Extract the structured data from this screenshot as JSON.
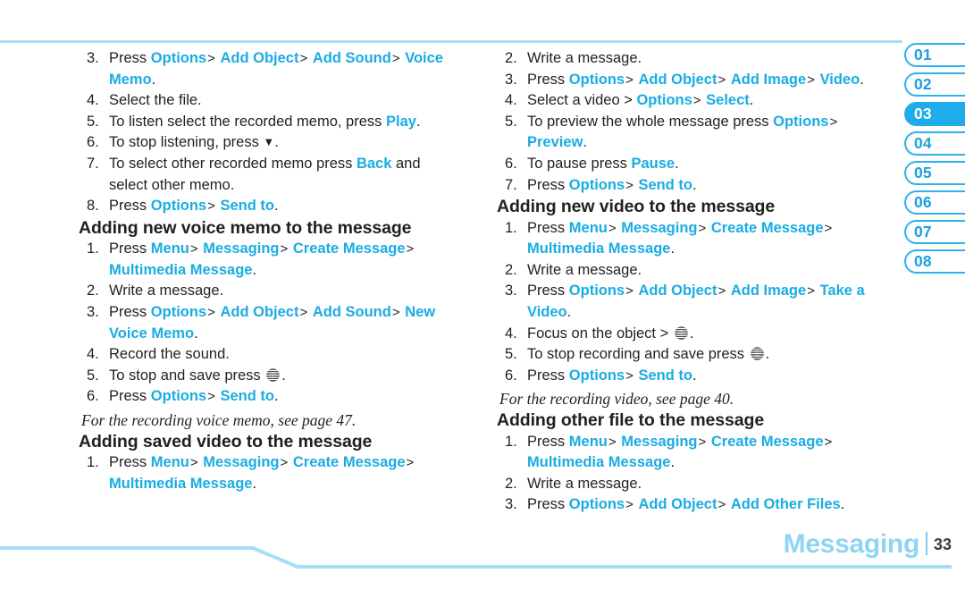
{
  "page": {
    "footer_title": "Messaging",
    "footer_page_number": "33",
    "accent_blue": "#19ace3",
    "rule_blue": "#a8ddf5",
    "tab_blue": "#2bb3ea",
    "tab_active_blue": "#1eadea",
    "footer_title_blue": "#8fd4f2",
    "body_black": "#231f20"
  },
  "tabs": [
    {
      "label": "01",
      "active": false
    },
    {
      "label": "02",
      "active": false
    },
    {
      "label": "03",
      "active": true
    },
    {
      "label": "04",
      "active": false
    },
    {
      "label": "05",
      "active": false
    },
    {
      "label": "06",
      "active": false
    },
    {
      "label": "07",
      "active": false
    },
    {
      "label": "08",
      "active": false
    }
  ],
  "left_column": {
    "continued_steps": [
      {
        "num": "3.",
        "text": "Press Options > Add Object > Add Sound > Voice Memo."
      },
      {
        "num": "4.",
        "text": "Select the file."
      },
      {
        "num": "5.",
        "text": "To listen select the recorded memo, press Play."
      },
      {
        "num": "6.",
        "text": "To stop listening, press ▼."
      },
      {
        "num": "7.",
        "text": "To select other recorded memo press Back and select other memo."
      },
      {
        "num": "8.",
        "text": "Press Options > Send to."
      }
    ],
    "section_voice_memo": {
      "heading": "Adding new voice memo to the message",
      "steps": [
        {
          "num": "1.",
          "text": "Press Menu > Messaging > Create Message > Multimedia Message."
        },
        {
          "num": "2.",
          "text": "Write a message."
        },
        {
          "num": "3.",
          "text": "Press Options > Add Object > Add Sound > New Voice Memo."
        },
        {
          "num": "4.",
          "text": "Record the sound."
        },
        {
          "num": "5.",
          "text": "To stop and save press [AT&T key]."
        },
        {
          "num": "6.",
          "text": "Press Options > Send to."
        }
      ],
      "footnote": "For the recording voice memo, see page 47."
    },
    "section_saved_video": {
      "heading": "Adding saved video to the message",
      "steps": [
        {
          "num": "1.",
          "text": "Press Menu > Messaging > Create Message > Multimedia Message."
        }
      ]
    }
  },
  "right_column": {
    "continued_steps": [
      {
        "num": "2.",
        "text": "Write a message."
      },
      {
        "num": "3.",
        "text": "Press Options > Add Object > Add Image > Video."
      },
      {
        "num": "4.",
        "text": "Select a video > Options > Select."
      },
      {
        "num": "5.",
        "text": "To preview the whole message press Options > Preview."
      },
      {
        "num": "6.",
        "text": "To pause press Pause."
      },
      {
        "num": "7.",
        "text": "Press Options > Send to."
      }
    ],
    "section_new_video": {
      "heading": "Adding new video to the message",
      "steps": [
        {
          "num": "1.",
          "text": "Press Menu > Messaging > Create Message > Multimedia Message."
        },
        {
          "num": "2.",
          "text": "Write a message."
        },
        {
          "num": "3.",
          "text": "Press Options > Add Object > Add Image > Take a Video."
        },
        {
          "num": "4.",
          "text": "Focus on the object > [AT&T key]."
        },
        {
          "num": "5.",
          "text": "To stop recording and save press [AT&T key]."
        },
        {
          "num": "6.",
          "text": "Press Options > Send to."
        }
      ],
      "footnote": "For the recording video, see page 40."
    },
    "section_other_file": {
      "heading": "Adding other file to the message",
      "steps": [
        {
          "num": "1.",
          "text": "Press Menu > Messaging > Create Message > Multimedia Message."
        },
        {
          "num": "2.",
          "text": "Write a message."
        },
        {
          "num": "3.",
          "text": "Press Options > Add Object > Add Other Files."
        }
      ]
    }
  },
  "keywords": {
    "press": "Press",
    "options": "Options",
    "add_object": "Add Object",
    "add_sound": "Add Sound",
    "voice_memo": "Voice Memo",
    "new_voice_memo": "New Voice Memo",
    "play": "Play",
    "back": "Back",
    "send_to": "Send to",
    "menu": "Menu",
    "messaging": "Messaging",
    "create_message": "Create Message",
    "multimedia_message": "Multimedia Message",
    "add_image": "Add Image",
    "video": "Video",
    "select": "Select",
    "preview": "Preview",
    "pause": "Pause",
    "take_a_video": "Take a Video",
    "add_other_files": "Add Other Files",
    "select_the_file": "Select the file.",
    "write_a_message": "Write a message.",
    "record_the_sound": "Record the sound.",
    "to_listen_prefix": "To listen select the recorded memo, press ",
    "to_stop_listening_prefix": "To stop listening, press ",
    "to_select_other_prefix": "To select other recorded memo press ",
    "to_select_other_suffix": " and select other memo.",
    "to_stop_save_prefix": "To stop and save press ",
    "select_a_video_prefix": "Select a video > ",
    "to_preview_prefix": "To preview the whole message press ",
    "to_pause_prefix": "To pause press ",
    "focus_prefix": "Focus on the object > ",
    "to_stop_rec_prefix": "To stop recording and save press ",
    "period": ".",
    "gt": ">"
  }
}
